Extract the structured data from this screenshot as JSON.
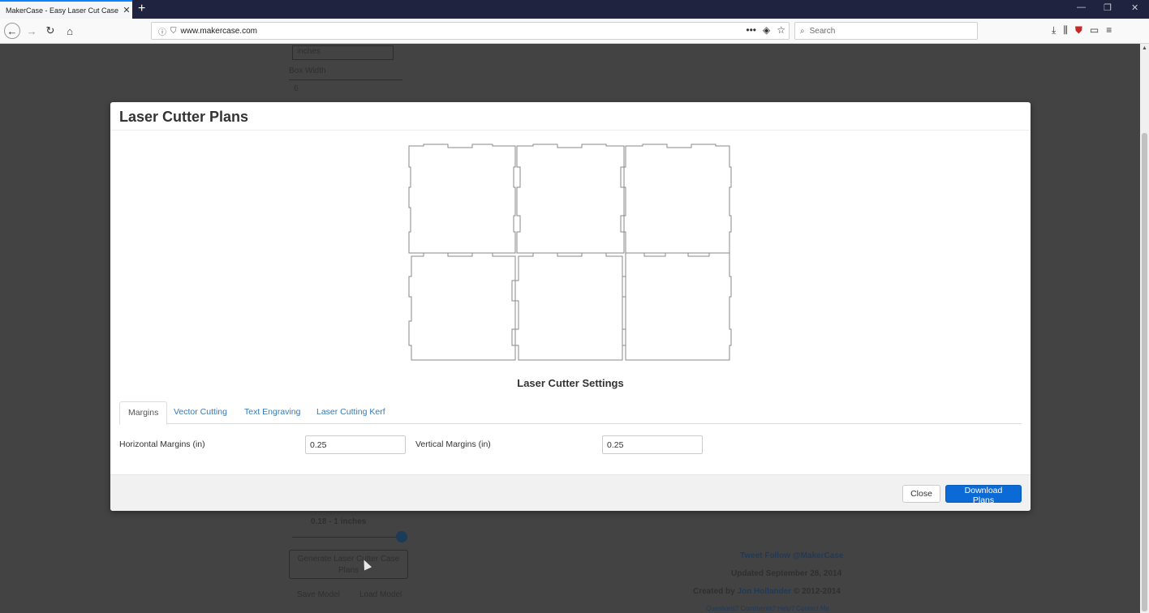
{
  "browser": {
    "tab_title": "MakerCase - Easy Laser Cut Case D",
    "tab_close": "✕",
    "new_tab": "+",
    "url": "www.makercase.com",
    "url_more": "•••",
    "search_placeholder": "Search",
    "window_controls": {
      "minimize": "—",
      "restore": "❐",
      "close": "✕"
    }
  },
  "background_page": {
    "top_left_field": "inches",
    "box_width_label": "Box Width",
    "box_width_value": "6",
    "slider_caption": "0.18 - 1 inches",
    "generate_button": "Generate Laser Cutter Case Plans",
    "save_model": "Save Model",
    "load_model": "Load Model",
    "tweet": "Tweet Follow @MakerCase",
    "updated": "Updated September 28, 2014",
    "created_prefix": "Created by ",
    "created_author": "Jon Hollander",
    "created_suffix": " © 2012-2014",
    "footer_links": "Questions? Comments? Help? Contact Me"
  },
  "modal": {
    "title": "Laser Cutter Plans",
    "settings_title": "Laser Cutter Settings",
    "tabs": [
      "Margins",
      "Vector Cutting",
      "Text Engraving",
      "Laser Cutting Kerf"
    ],
    "active_tab": "Margins",
    "fields": {
      "horizontal_label": "Horizontal Margins (in)",
      "horizontal_value": "0.25",
      "vertical_label": "Vertical Margins (in)",
      "vertical_value": "0.25"
    },
    "close_button": "Close",
    "download_button": "Download Plans"
  },
  "colors": {
    "primary_button": "#0b6ad6",
    "tab_link": "#337ab7",
    "browser_titlebar": "#202340",
    "overlay_dim": "#434343"
  }
}
